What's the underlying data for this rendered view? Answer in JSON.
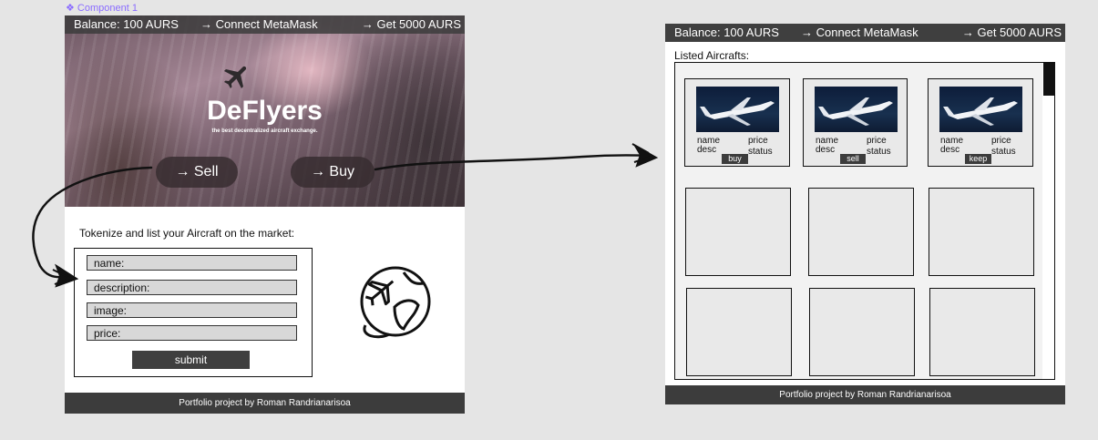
{
  "canvas": {
    "component_label": "❖ Component 1"
  },
  "left_frame": {
    "topbar": {
      "balance": "Balance: 100 AURS",
      "connect": "→ Connect MetaMask",
      "faucet": "→ Get 5000 AURS"
    },
    "hero": {
      "title": "DeFlyers",
      "tagline": "the best decentralized aircraft exchange.",
      "sell_label": "→  Sell",
      "buy_label": "→  Buy"
    },
    "form": {
      "title": "Tokenize and list your Aircraft on the market:",
      "fields": [
        {
          "label": "name:"
        },
        {
          "label": "description:"
        },
        {
          "label": "image:"
        },
        {
          "label": "price:"
        }
      ],
      "submit_label": "submit"
    },
    "footer": "Portfolio project by Roman Randrianarisoa"
  },
  "right_frame": {
    "topbar": {
      "balance": "Balance: 100 AURS",
      "connect": "→ Connect MetaMask",
      "faucet": "→ Get 5000 AURS"
    },
    "listed_title": "Listed Aircrafts:",
    "cards": [
      {
        "name": "name",
        "desc": "desc",
        "price": "price",
        "status": "status",
        "action": "buy"
      },
      {
        "name": "name",
        "desc": "desc",
        "price": "price",
        "status": "status",
        "action": "sell"
      },
      {
        "name": "name",
        "desc": "desc",
        "price": "price",
        "status": "status",
        "action": "keep"
      }
    ],
    "footer": "Portfolio project by Roman Randrianarisoa"
  },
  "icons": {
    "hero_icon": "airplane-icon",
    "form_icon": "globe-airplane-icon",
    "arrows": "hand-drawn-arrow-icon"
  }
}
